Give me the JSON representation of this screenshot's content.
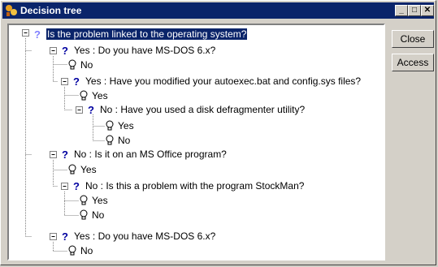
{
  "window": {
    "title": "Decision tree",
    "controls": {
      "minimize": "_",
      "maximize": "□",
      "close": "✕"
    }
  },
  "buttons": {
    "close_label": "Close",
    "access_label": "Access"
  },
  "tree": {
    "root": "Is the problem linked to the operating system?",
    "nodes": [
      "Yes : Do you have MS-DOS 6.x?",
      "No",
      "Yes : Have you modified your autoexec.bat and config.sys files?",
      "Yes",
      "No : Have you used a disk defragmenter utility?",
      "Yes",
      "No",
      "No : Is it on an MS Office program?",
      "Yes",
      "No : Is this a problem with the program StockMan?",
      "Yes",
      "No",
      "Yes : Do you have MS-DOS 6.x?",
      "No"
    ]
  },
  "colors": {
    "title_bar": "#0a246a",
    "question_icon": "#0000a0",
    "selection": "#0a246a"
  }
}
